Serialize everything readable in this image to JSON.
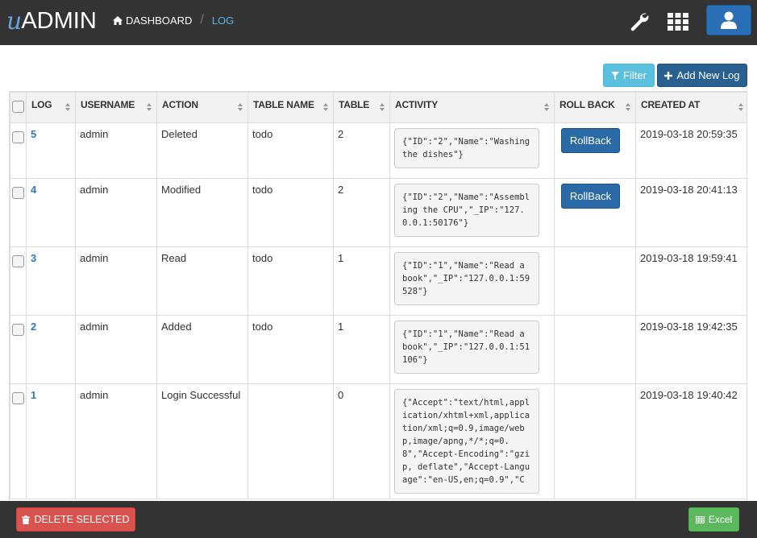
{
  "nav": {
    "logo_u": "u",
    "logo_admin": "ADMIN",
    "breadcrumb": {
      "dashboard": "DASHBOARD",
      "separator": "/",
      "current": "LOG"
    },
    "icons": [
      "home-icon",
      "wrench-icon",
      "grid-icon",
      "user-icon"
    ]
  },
  "toolbar": {
    "filter_label": "Filter",
    "add_label": "Add New Log"
  },
  "table": {
    "columns": [
      "LOG",
      "USERNAME",
      "ACTION",
      "TABLE NAME",
      "TABLE",
      "ACTIVITY",
      "ROLL BACK",
      "CREATED AT"
    ],
    "rows": [
      {
        "log": "5",
        "username": "admin",
        "action": "Deleted",
        "table_name": "todo",
        "table": "2",
        "activity": "{\"ID\":\"2\",\"Name\":\"Washing the dishes\"}",
        "rollback": "RollBack",
        "created_at": "2019-03-18 20:59:35"
      },
      {
        "log": "4",
        "username": "admin",
        "action": "Modified",
        "table_name": "todo",
        "table": "2",
        "activity": "{\"ID\":\"2\",\"Name\":\"Assembling the CPU\",\"_IP\":\"127.0.0.1:50176\"}",
        "rollback": "RollBack",
        "created_at": "2019-03-18 20:41:13"
      },
      {
        "log": "3",
        "username": "admin",
        "action": "Read",
        "table_name": "todo",
        "table": "1",
        "activity": "{\"ID\":\"1\",\"Name\":\"Read a book\",\"_IP\":\"127.0.0.1:59528\"}",
        "rollback": "",
        "created_at": "2019-03-18 19:59:41"
      },
      {
        "log": "2",
        "username": "admin",
        "action": "Added",
        "table_name": "todo",
        "table": "1",
        "activity": "{\"ID\":\"1\",\"Name\":\"Read a book\",\"_IP\":\"127.0.0.1:51106\"}",
        "rollback": "",
        "created_at": "2019-03-18 19:42:35"
      },
      {
        "log": "1",
        "username": "admin",
        "action": "Login Successful",
        "table_name": "",
        "table": "0",
        "activity": "{\"Accept\":\"text/html,application/xhtml+xml,application/xml;q=0.9,image/webp,image/apng,*/*;q=0.8\",\"Accept-Encoding\":\"gzip, deflate\",\"Accept-Language\":\"en-US,en;q=0.9\",\"C",
        "rollback": "",
        "created_at": "2019-03-18 19:40:42"
      }
    ]
  },
  "footer": {
    "delete_label": "DELETE SELECTED",
    "excel_label": "Excel"
  },
  "colors": {
    "navbar": "#333333",
    "accent": "#5bb2e4",
    "primary": "#286090",
    "info": "#5bc0de",
    "danger": "#d9534f",
    "success": "#5cb85c"
  }
}
